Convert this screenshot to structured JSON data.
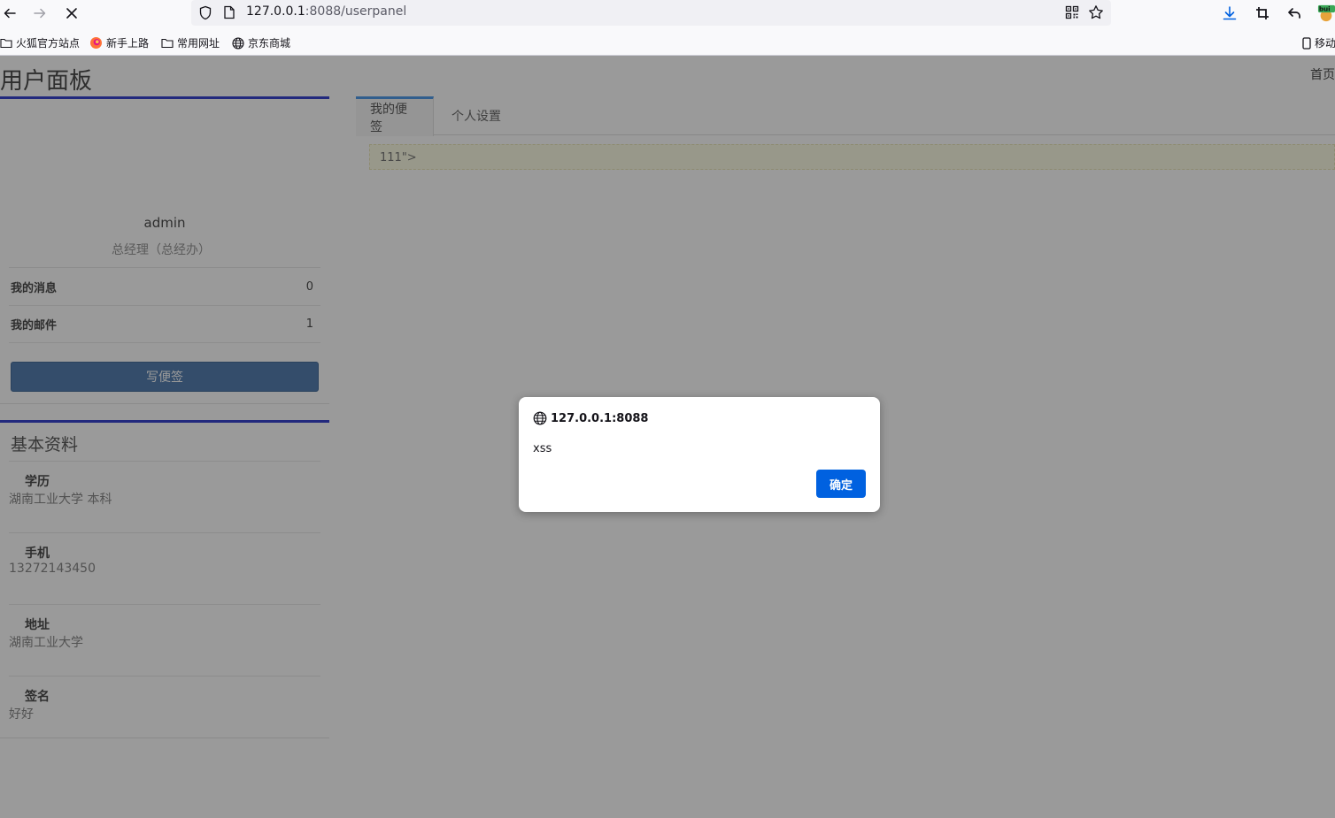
{
  "browser": {
    "url_host": "127.0.0.1",
    "url_rest": ":8088/userpanel",
    "bookmarks": [
      {
        "label": "火狐官方站点",
        "icon": "folder-icon"
      },
      {
        "label": "新手上路",
        "icon": "firefox-icon"
      },
      {
        "label": "常用网址",
        "icon": "folder-icon"
      },
      {
        "label": "京东商城",
        "icon": "globe-icon"
      }
    ],
    "mobile_bookmarks": "移动",
    "extension_badge": "bui"
  },
  "page": {
    "title": "用户面板",
    "home_link": "首页",
    "profile": {
      "username": "admin",
      "role": "总经理（总经办）",
      "stats": [
        {
          "label": "我的消息",
          "count": "0"
        },
        {
          "label": "我的邮件",
          "count": "1"
        }
      ],
      "write_note_button": "写便签"
    },
    "basic_info": {
      "title": "基本资料",
      "items": [
        {
          "key": "学历",
          "value": "湖南工业大学 本科"
        },
        {
          "key": "手机",
          "value": "13272143450"
        },
        {
          "key": "地址",
          "value": "湖南工业大学"
        },
        {
          "key": "签名",
          "value": "好好"
        }
      ]
    },
    "tabs": [
      {
        "label": "我的便签",
        "active": true
      },
      {
        "label": "个人设置",
        "active": false
      }
    ],
    "note_text": "111\">"
  },
  "alert": {
    "origin": "127.0.0.1:8088",
    "message": "xss",
    "ok_label": "确定"
  },
  "colors": {
    "accent_border": "#1d2ac9",
    "button_blue": "#3f6fa6",
    "dialog_button": "#0061e0",
    "note_background": "#fcfce0"
  }
}
